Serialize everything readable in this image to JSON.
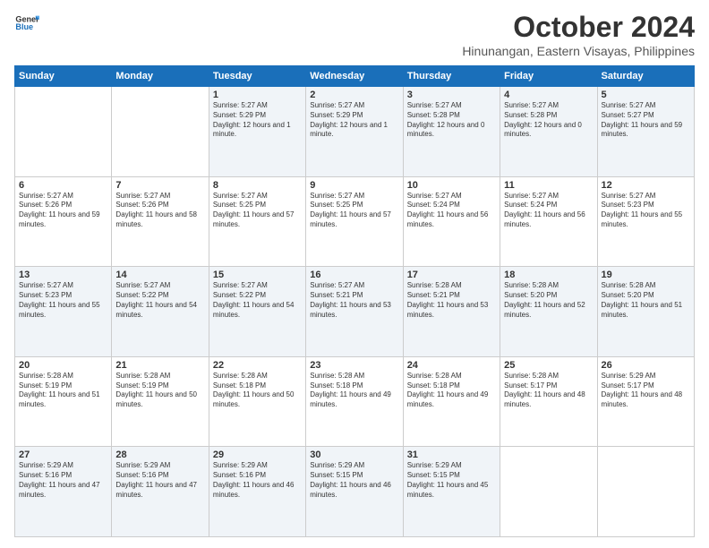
{
  "header": {
    "logo_line1": "General",
    "logo_line2": "Blue",
    "month": "October 2024",
    "location": "Hinunangan, Eastern Visayas, Philippines"
  },
  "weekdays": [
    "Sunday",
    "Monday",
    "Tuesday",
    "Wednesday",
    "Thursday",
    "Friday",
    "Saturday"
  ],
  "weeks": [
    [
      {
        "day": "",
        "sunrise": "",
        "sunset": "",
        "daylight": ""
      },
      {
        "day": "",
        "sunrise": "",
        "sunset": "",
        "daylight": ""
      },
      {
        "day": "1",
        "sunrise": "Sunrise: 5:27 AM",
        "sunset": "Sunset: 5:29 PM",
        "daylight": "Daylight: 12 hours and 1 minute."
      },
      {
        "day": "2",
        "sunrise": "Sunrise: 5:27 AM",
        "sunset": "Sunset: 5:29 PM",
        "daylight": "Daylight: 12 hours and 1 minute."
      },
      {
        "day": "3",
        "sunrise": "Sunrise: 5:27 AM",
        "sunset": "Sunset: 5:28 PM",
        "daylight": "Daylight: 12 hours and 0 minutes."
      },
      {
        "day": "4",
        "sunrise": "Sunrise: 5:27 AM",
        "sunset": "Sunset: 5:28 PM",
        "daylight": "Daylight: 12 hours and 0 minutes."
      },
      {
        "day": "5",
        "sunrise": "Sunrise: 5:27 AM",
        "sunset": "Sunset: 5:27 PM",
        "daylight": "Daylight: 11 hours and 59 minutes."
      }
    ],
    [
      {
        "day": "6",
        "sunrise": "Sunrise: 5:27 AM",
        "sunset": "Sunset: 5:26 PM",
        "daylight": "Daylight: 11 hours and 59 minutes."
      },
      {
        "day": "7",
        "sunrise": "Sunrise: 5:27 AM",
        "sunset": "Sunset: 5:26 PM",
        "daylight": "Daylight: 11 hours and 58 minutes."
      },
      {
        "day": "8",
        "sunrise": "Sunrise: 5:27 AM",
        "sunset": "Sunset: 5:25 PM",
        "daylight": "Daylight: 11 hours and 57 minutes."
      },
      {
        "day": "9",
        "sunrise": "Sunrise: 5:27 AM",
        "sunset": "Sunset: 5:25 PM",
        "daylight": "Daylight: 11 hours and 57 minutes."
      },
      {
        "day": "10",
        "sunrise": "Sunrise: 5:27 AM",
        "sunset": "Sunset: 5:24 PM",
        "daylight": "Daylight: 11 hours and 56 minutes."
      },
      {
        "day": "11",
        "sunrise": "Sunrise: 5:27 AM",
        "sunset": "Sunset: 5:24 PM",
        "daylight": "Daylight: 11 hours and 56 minutes."
      },
      {
        "day": "12",
        "sunrise": "Sunrise: 5:27 AM",
        "sunset": "Sunset: 5:23 PM",
        "daylight": "Daylight: 11 hours and 55 minutes."
      }
    ],
    [
      {
        "day": "13",
        "sunrise": "Sunrise: 5:27 AM",
        "sunset": "Sunset: 5:23 PM",
        "daylight": "Daylight: 11 hours and 55 minutes."
      },
      {
        "day": "14",
        "sunrise": "Sunrise: 5:27 AM",
        "sunset": "Sunset: 5:22 PM",
        "daylight": "Daylight: 11 hours and 54 minutes."
      },
      {
        "day": "15",
        "sunrise": "Sunrise: 5:27 AM",
        "sunset": "Sunset: 5:22 PM",
        "daylight": "Daylight: 11 hours and 54 minutes."
      },
      {
        "day": "16",
        "sunrise": "Sunrise: 5:27 AM",
        "sunset": "Sunset: 5:21 PM",
        "daylight": "Daylight: 11 hours and 53 minutes."
      },
      {
        "day": "17",
        "sunrise": "Sunrise: 5:28 AM",
        "sunset": "Sunset: 5:21 PM",
        "daylight": "Daylight: 11 hours and 53 minutes."
      },
      {
        "day": "18",
        "sunrise": "Sunrise: 5:28 AM",
        "sunset": "Sunset: 5:20 PM",
        "daylight": "Daylight: 11 hours and 52 minutes."
      },
      {
        "day": "19",
        "sunrise": "Sunrise: 5:28 AM",
        "sunset": "Sunset: 5:20 PM",
        "daylight": "Daylight: 11 hours and 51 minutes."
      }
    ],
    [
      {
        "day": "20",
        "sunrise": "Sunrise: 5:28 AM",
        "sunset": "Sunset: 5:19 PM",
        "daylight": "Daylight: 11 hours and 51 minutes."
      },
      {
        "day": "21",
        "sunrise": "Sunrise: 5:28 AM",
        "sunset": "Sunset: 5:19 PM",
        "daylight": "Daylight: 11 hours and 50 minutes."
      },
      {
        "day": "22",
        "sunrise": "Sunrise: 5:28 AM",
        "sunset": "Sunset: 5:18 PM",
        "daylight": "Daylight: 11 hours and 50 minutes."
      },
      {
        "day": "23",
        "sunrise": "Sunrise: 5:28 AM",
        "sunset": "Sunset: 5:18 PM",
        "daylight": "Daylight: 11 hours and 49 minutes."
      },
      {
        "day": "24",
        "sunrise": "Sunrise: 5:28 AM",
        "sunset": "Sunset: 5:18 PM",
        "daylight": "Daylight: 11 hours and 49 minutes."
      },
      {
        "day": "25",
        "sunrise": "Sunrise: 5:28 AM",
        "sunset": "Sunset: 5:17 PM",
        "daylight": "Daylight: 11 hours and 48 minutes."
      },
      {
        "day": "26",
        "sunrise": "Sunrise: 5:29 AM",
        "sunset": "Sunset: 5:17 PM",
        "daylight": "Daylight: 11 hours and 48 minutes."
      }
    ],
    [
      {
        "day": "27",
        "sunrise": "Sunrise: 5:29 AM",
        "sunset": "Sunset: 5:16 PM",
        "daylight": "Daylight: 11 hours and 47 minutes."
      },
      {
        "day": "28",
        "sunrise": "Sunrise: 5:29 AM",
        "sunset": "Sunset: 5:16 PM",
        "daylight": "Daylight: 11 hours and 47 minutes."
      },
      {
        "day": "29",
        "sunrise": "Sunrise: 5:29 AM",
        "sunset": "Sunset: 5:16 PM",
        "daylight": "Daylight: 11 hours and 46 minutes."
      },
      {
        "day": "30",
        "sunrise": "Sunrise: 5:29 AM",
        "sunset": "Sunset: 5:15 PM",
        "daylight": "Daylight: 11 hours and 46 minutes."
      },
      {
        "day": "31",
        "sunrise": "Sunrise: 5:29 AM",
        "sunset": "Sunset: 5:15 PM",
        "daylight": "Daylight: 11 hours and 45 minutes."
      },
      {
        "day": "",
        "sunrise": "",
        "sunset": "",
        "daylight": ""
      },
      {
        "day": "",
        "sunrise": "",
        "sunset": "",
        "daylight": ""
      }
    ]
  ]
}
